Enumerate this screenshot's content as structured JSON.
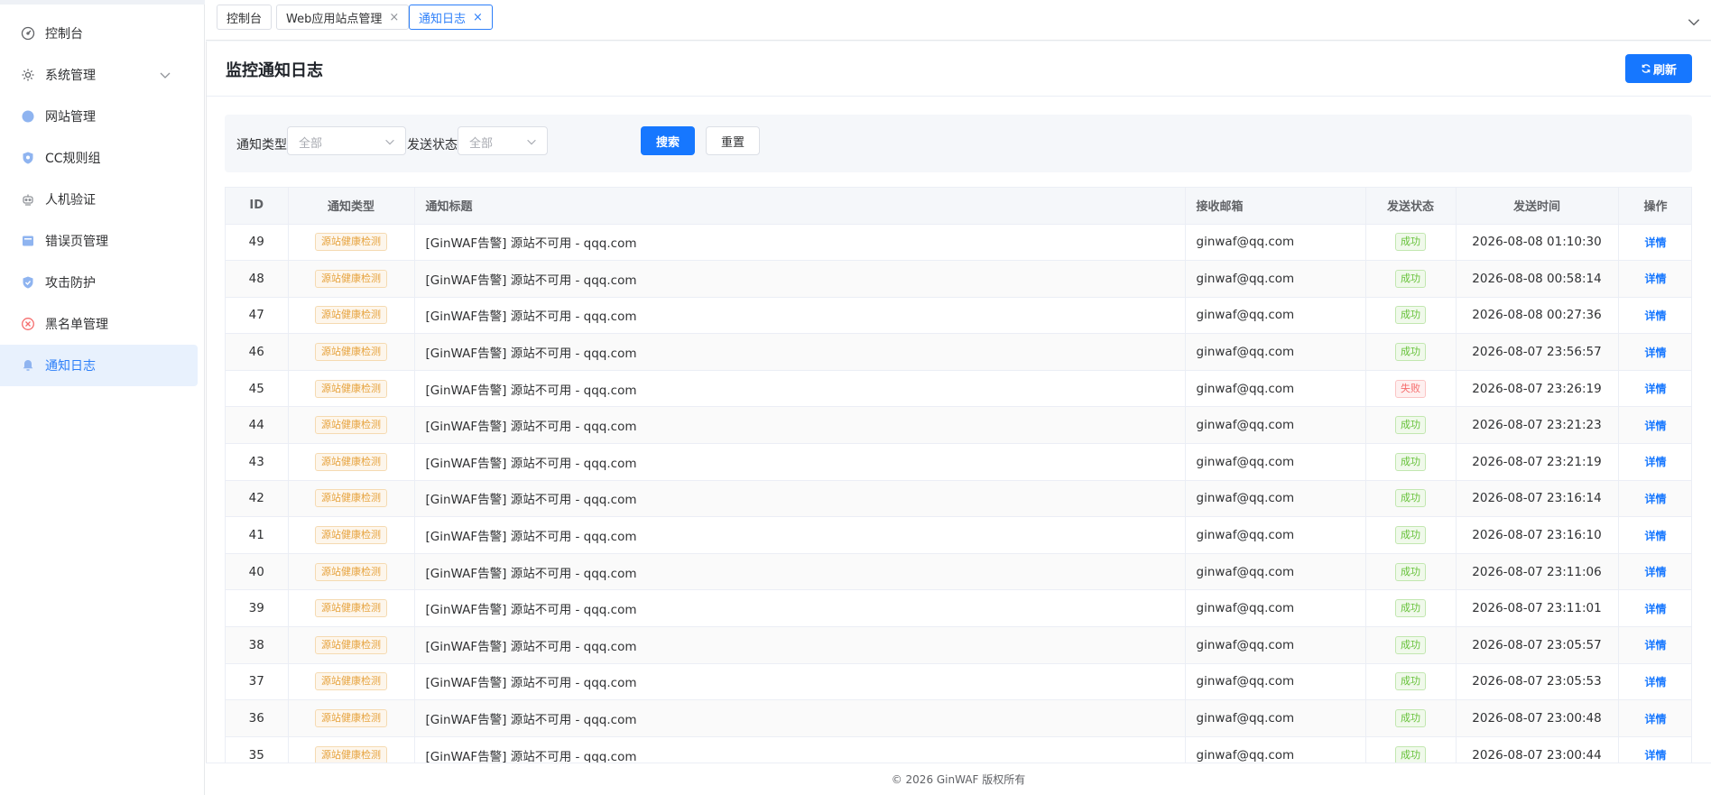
{
  "sidebar": {
    "items": [
      {
        "label": "控制台",
        "icon": "dashboard-icon"
      },
      {
        "label": "系统管理",
        "icon": "gear-icon",
        "expandable": true
      },
      {
        "label": "网站管理",
        "icon": "globe-icon"
      },
      {
        "label": "CC规则组",
        "icon": "shield-icon"
      },
      {
        "label": "人机验证",
        "icon": "robot-icon"
      },
      {
        "label": "错误页管理",
        "icon": "page-icon"
      },
      {
        "label": "攻击防护",
        "icon": "shield-check-icon"
      },
      {
        "label": "黑名单管理",
        "icon": "block-icon"
      },
      {
        "label": "通知日志",
        "icon": "bell-icon",
        "active": true
      }
    ]
  },
  "tabs": [
    {
      "label": "控制台",
      "closable": false
    },
    {
      "label": "Web应用站点管理",
      "closable": true
    },
    {
      "label": "通知日志",
      "closable": true,
      "active": true
    }
  ],
  "page": {
    "title": "监控通知日志",
    "refresh_label": "刷新"
  },
  "filter": {
    "type_label": "通知类型",
    "type_value": "全部",
    "status_label": "发送状态",
    "status_value": "全部",
    "search_label": "搜索",
    "reset_label": "重置"
  },
  "table": {
    "headers": [
      "ID",
      "通知类型",
      "通知标题",
      "接收邮箱",
      "发送状态",
      "发送时间",
      "操作"
    ],
    "rows": [
      {
        "id": "49",
        "type": "源站健康检测",
        "title": "[GinWAF告警] 源站不可用 - qqq.com",
        "email": "ginwaf@qq.com",
        "status": "成功",
        "ok": true,
        "time": "2026-08-08 01:10:30",
        "action": "详情"
      },
      {
        "id": "48",
        "type": "源站健康检测",
        "title": "[GinWAF告警] 源站不可用 - qqq.com",
        "email": "ginwaf@qq.com",
        "status": "成功",
        "ok": true,
        "time": "2026-08-08 00:58:14",
        "action": "详情"
      },
      {
        "id": "47",
        "type": "源站健康检测",
        "title": "[GinWAF告警] 源站不可用 - qqq.com",
        "email": "ginwaf@qq.com",
        "status": "成功",
        "ok": true,
        "time": "2026-08-08 00:27:36",
        "action": "详情"
      },
      {
        "id": "46",
        "type": "源站健康检测",
        "title": "[GinWAF告警] 源站不可用 - qqq.com",
        "email": "ginwaf@qq.com",
        "status": "成功",
        "ok": true,
        "time": "2026-08-07 23:56:57",
        "action": "详情"
      },
      {
        "id": "45",
        "type": "源站健康检测",
        "title": "[GinWAF告警] 源站不可用 - qqq.com",
        "email": "ginwaf@qq.com",
        "status": "失败",
        "ok": false,
        "time": "2026-08-07 23:26:19",
        "action": "详情"
      },
      {
        "id": "44",
        "type": "源站健康检测",
        "title": "[GinWAF告警] 源站不可用 - qqq.com",
        "email": "ginwaf@qq.com",
        "status": "成功",
        "ok": true,
        "time": "2026-08-07 23:21:23",
        "action": "详情"
      },
      {
        "id": "43",
        "type": "源站健康检测",
        "title": "[GinWAF告警] 源站不可用 - qqq.com",
        "email": "ginwaf@qq.com",
        "status": "成功",
        "ok": true,
        "time": "2026-08-07 23:21:19",
        "action": "详情"
      },
      {
        "id": "42",
        "type": "源站健康检测",
        "title": "[GinWAF告警] 源站不可用 - qqq.com",
        "email": "ginwaf@qq.com",
        "status": "成功",
        "ok": true,
        "time": "2026-08-07 23:16:14",
        "action": "详情"
      },
      {
        "id": "41",
        "type": "源站健康检测",
        "title": "[GinWAF告警] 源站不可用 - qqq.com",
        "email": "ginwaf@qq.com",
        "status": "成功",
        "ok": true,
        "time": "2026-08-07 23:16:10",
        "action": "详情"
      },
      {
        "id": "40",
        "type": "源站健康检测",
        "title": "[GinWAF告警] 源站不可用 - qqq.com",
        "email": "ginwaf@qq.com",
        "status": "成功",
        "ok": true,
        "time": "2026-08-07 23:11:06",
        "action": "详情"
      },
      {
        "id": "39",
        "type": "源站健康检测",
        "title": "[GinWAF告警] 源站不可用 - qqq.com",
        "email": "ginwaf@qq.com",
        "status": "成功",
        "ok": true,
        "time": "2026-08-07 23:11:01",
        "action": "详情"
      },
      {
        "id": "38",
        "type": "源站健康检测",
        "title": "[GinWAF告警] 源站不可用 - qqq.com",
        "email": "ginwaf@qq.com",
        "status": "成功",
        "ok": true,
        "time": "2026-08-07 23:05:57",
        "action": "详情"
      },
      {
        "id": "37",
        "type": "源站健康检测",
        "title": "[GinWAF告警] 源站不可用 - qqq.com",
        "email": "ginwaf@qq.com",
        "status": "成功",
        "ok": true,
        "time": "2026-08-07 23:05:53",
        "action": "详情"
      },
      {
        "id": "36",
        "type": "源站健康检测",
        "title": "[GinWAF告警] 源站不可用 - qqq.com",
        "email": "ginwaf@qq.com",
        "status": "成功",
        "ok": true,
        "time": "2026-08-07 23:00:48",
        "action": "详情"
      },
      {
        "id": "35",
        "type": "源站健康检测",
        "title": "[GinWAF告警] 源站不可用 - qqq.com",
        "email": "ginwaf@qq.com",
        "status": "成功",
        "ok": true,
        "time": "2026-08-07 23:00:44",
        "action": "详情"
      }
    ]
  },
  "footer": {
    "text": "© 2026 GinWAF 版权所有"
  },
  "colors": {
    "accent": "#1677ff",
    "active_bg": "#e8f1fd",
    "success": "#67c23a",
    "danger": "#f56c6c",
    "warning": "#e6a23c"
  }
}
